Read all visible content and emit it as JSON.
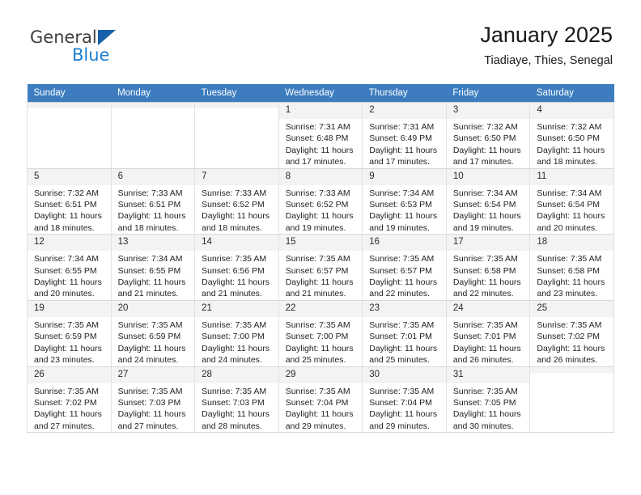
{
  "brand": {
    "word1": "General",
    "word2": "Blue",
    "triangle_color": "#1761ab",
    "blue_color": "#1d7fd4"
  },
  "header": {
    "title": "January 2025",
    "subtitle": "Tiadiaye, Thies, Senegal"
  },
  "theme": {
    "header_row_bg": "#3d7dbf",
    "daynum_bg": "#f3f3f3",
    "grid_border": "#e2e2e2"
  },
  "calendar": {
    "weekdays": [
      "Sunday",
      "Monday",
      "Tuesday",
      "Wednesday",
      "Thursday",
      "Friday",
      "Saturday"
    ],
    "weeks": [
      [
        {
          "day": "",
          "empty": true,
          "sunrise": "",
          "sunset": "",
          "daylight1": "",
          "daylight2": ""
        },
        {
          "day": "",
          "empty": true,
          "sunrise": "",
          "sunset": "",
          "daylight1": "",
          "daylight2": ""
        },
        {
          "day": "",
          "empty": true,
          "sunrise": "",
          "sunset": "",
          "daylight1": "",
          "daylight2": ""
        },
        {
          "day": "1",
          "empty": false,
          "sunrise": "Sunrise: 7:31 AM",
          "sunset": "Sunset: 6:48 PM",
          "daylight1": "Daylight: 11 hours",
          "daylight2": "and 17 minutes."
        },
        {
          "day": "2",
          "empty": false,
          "sunrise": "Sunrise: 7:31 AM",
          "sunset": "Sunset: 6:49 PM",
          "daylight1": "Daylight: 11 hours",
          "daylight2": "and 17 minutes."
        },
        {
          "day": "3",
          "empty": false,
          "sunrise": "Sunrise: 7:32 AM",
          "sunset": "Sunset: 6:50 PM",
          "daylight1": "Daylight: 11 hours",
          "daylight2": "and 17 minutes."
        },
        {
          "day": "4",
          "empty": false,
          "sunrise": "Sunrise: 7:32 AM",
          "sunset": "Sunset: 6:50 PM",
          "daylight1": "Daylight: 11 hours",
          "daylight2": "and 18 minutes."
        }
      ],
      [
        {
          "day": "5",
          "empty": false,
          "sunrise": "Sunrise: 7:32 AM",
          "sunset": "Sunset: 6:51 PM",
          "daylight1": "Daylight: 11 hours",
          "daylight2": "and 18 minutes."
        },
        {
          "day": "6",
          "empty": false,
          "sunrise": "Sunrise: 7:33 AM",
          "sunset": "Sunset: 6:51 PM",
          "daylight1": "Daylight: 11 hours",
          "daylight2": "and 18 minutes."
        },
        {
          "day": "7",
          "empty": false,
          "sunrise": "Sunrise: 7:33 AM",
          "sunset": "Sunset: 6:52 PM",
          "daylight1": "Daylight: 11 hours",
          "daylight2": "and 18 minutes."
        },
        {
          "day": "8",
          "empty": false,
          "sunrise": "Sunrise: 7:33 AM",
          "sunset": "Sunset: 6:52 PM",
          "daylight1": "Daylight: 11 hours",
          "daylight2": "and 19 minutes."
        },
        {
          "day": "9",
          "empty": false,
          "sunrise": "Sunrise: 7:34 AM",
          "sunset": "Sunset: 6:53 PM",
          "daylight1": "Daylight: 11 hours",
          "daylight2": "and 19 minutes."
        },
        {
          "day": "10",
          "empty": false,
          "sunrise": "Sunrise: 7:34 AM",
          "sunset": "Sunset: 6:54 PM",
          "daylight1": "Daylight: 11 hours",
          "daylight2": "and 19 minutes."
        },
        {
          "day": "11",
          "empty": false,
          "sunrise": "Sunrise: 7:34 AM",
          "sunset": "Sunset: 6:54 PM",
          "daylight1": "Daylight: 11 hours",
          "daylight2": "and 20 minutes."
        }
      ],
      [
        {
          "day": "12",
          "empty": false,
          "sunrise": "Sunrise: 7:34 AM",
          "sunset": "Sunset: 6:55 PM",
          "daylight1": "Daylight: 11 hours",
          "daylight2": "and 20 minutes."
        },
        {
          "day": "13",
          "empty": false,
          "sunrise": "Sunrise: 7:34 AM",
          "sunset": "Sunset: 6:55 PM",
          "daylight1": "Daylight: 11 hours",
          "daylight2": "and 21 minutes."
        },
        {
          "day": "14",
          "empty": false,
          "sunrise": "Sunrise: 7:35 AM",
          "sunset": "Sunset: 6:56 PM",
          "daylight1": "Daylight: 11 hours",
          "daylight2": "and 21 minutes."
        },
        {
          "day": "15",
          "empty": false,
          "sunrise": "Sunrise: 7:35 AM",
          "sunset": "Sunset: 6:57 PM",
          "daylight1": "Daylight: 11 hours",
          "daylight2": "and 21 minutes."
        },
        {
          "day": "16",
          "empty": false,
          "sunrise": "Sunrise: 7:35 AM",
          "sunset": "Sunset: 6:57 PM",
          "daylight1": "Daylight: 11 hours",
          "daylight2": "and 22 minutes."
        },
        {
          "day": "17",
          "empty": false,
          "sunrise": "Sunrise: 7:35 AM",
          "sunset": "Sunset: 6:58 PM",
          "daylight1": "Daylight: 11 hours",
          "daylight2": "and 22 minutes."
        },
        {
          "day": "18",
          "empty": false,
          "sunrise": "Sunrise: 7:35 AM",
          "sunset": "Sunset: 6:58 PM",
          "daylight1": "Daylight: 11 hours",
          "daylight2": "and 23 minutes."
        }
      ],
      [
        {
          "day": "19",
          "empty": false,
          "sunrise": "Sunrise: 7:35 AM",
          "sunset": "Sunset: 6:59 PM",
          "daylight1": "Daylight: 11 hours",
          "daylight2": "and 23 minutes."
        },
        {
          "day": "20",
          "empty": false,
          "sunrise": "Sunrise: 7:35 AM",
          "sunset": "Sunset: 6:59 PM",
          "daylight1": "Daylight: 11 hours",
          "daylight2": "and 24 minutes."
        },
        {
          "day": "21",
          "empty": false,
          "sunrise": "Sunrise: 7:35 AM",
          "sunset": "Sunset: 7:00 PM",
          "daylight1": "Daylight: 11 hours",
          "daylight2": "and 24 minutes."
        },
        {
          "day": "22",
          "empty": false,
          "sunrise": "Sunrise: 7:35 AM",
          "sunset": "Sunset: 7:00 PM",
          "daylight1": "Daylight: 11 hours",
          "daylight2": "and 25 minutes."
        },
        {
          "day": "23",
          "empty": false,
          "sunrise": "Sunrise: 7:35 AM",
          "sunset": "Sunset: 7:01 PM",
          "daylight1": "Daylight: 11 hours",
          "daylight2": "and 25 minutes."
        },
        {
          "day": "24",
          "empty": false,
          "sunrise": "Sunrise: 7:35 AM",
          "sunset": "Sunset: 7:01 PM",
          "daylight1": "Daylight: 11 hours",
          "daylight2": "and 26 minutes."
        },
        {
          "day": "25",
          "empty": false,
          "sunrise": "Sunrise: 7:35 AM",
          "sunset": "Sunset: 7:02 PM",
          "daylight1": "Daylight: 11 hours",
          "daylight2": "and 26 minutes."
        }
      ],
      [
        {
          "day": "26",
          "empty": false,
          "sunrise": "Sunrise: 7:35 AM",
          "sunset": "Sunset: 7:02 PM",
          "daylight1": "Daylight: 11 hours",
          "daylight2": "and 27 minutes."
        },
        {
          "day": "27",
          "empty": false,
          "sunrise": "Sunrise: 7:35 AM",
          "sunset": "Sunset: 7:03 PM",
          "daylight1": "Daylight: 11 hours",
          "daylight2": "and 27 minutes."
        },
        {
          "day": "28",
          "empty": false,
          "sunrise": "Sunrise: 7:35 AM",
          "sunset": "Sunset: 7:03 PM",
          "daylight1": "Daylight: 11 hours",
          "daylight2": "and 28 minutes."
        },
        {
          "day": "29",
          "empty": false,
          "sunrise": "Sunrise: 7:35 AM",
          "sunset": "Sunset: 7:04 PM",
          "daylight1": "Daylight: 11 hours",
          "daylight2": "and 29 minutes."
        },
        {
          "day": "30",
          "empty": false,
          "sunrise": "Sunrise: 7:35 AM",
          "sunset": "Sunset: 7:04 PM",
          "daylight1": "Daylight: 11 hours",
          "daylight2": "and 29 minutes."
        },
        {
          "day": "31",
          "empty": false,
          "sunrise": "Sunrise: 7:35 AM",
          "sunset": "Sunset: 7:05 PM",
          "daylight1": "Daylight: 11 hours",
          "daylight2": "and 30 minutes."
        },
        {
          "day": "",
          "empty": true,
          "sunrise": "",
          "sunset": "",
          "daylight1": "",
          "daylight2": ""
        }
      ]
    ]
  }
}
